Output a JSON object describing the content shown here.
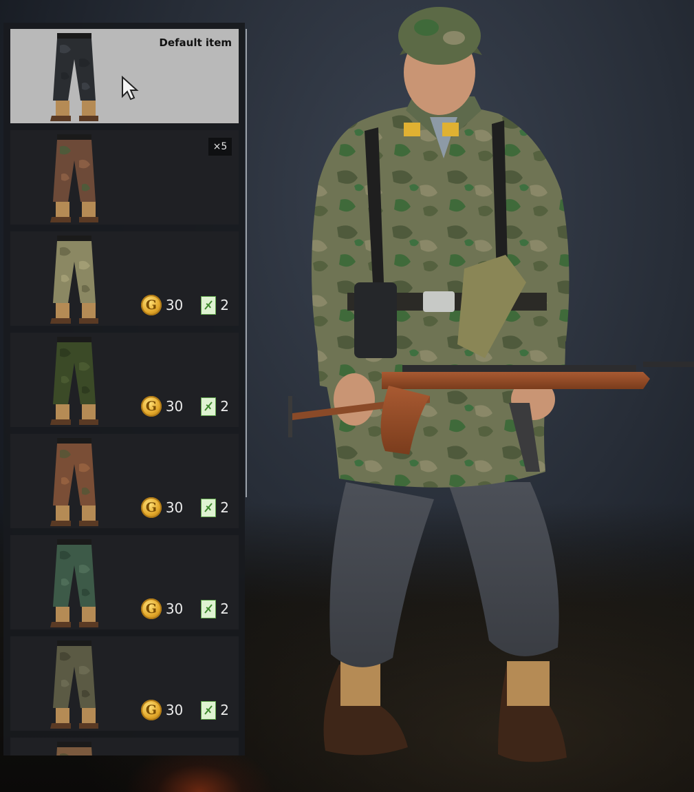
{
  "panel": {
    "items": [
      {
        "label": "Default item",
        "selected": true,
        "camo": [
          "#2a2d31",
          "#3b3f45",
          "#23262a"
        ]
      },
      {
        "badge": "×5",
        "camo": [
          "#6d4a38",
          "#4f5a3a",
          "#8a5e44"
        ]
      },
      {
        "price": {
          "gold": "30",
          "tickets": "2"
        },
        "camo": [
          "#8b8863",
          "#6e6c4c",
          "#a29d74"
        ]
      },
      {
        "price": {
          "gold": "30",
          "tickets": "2"
        },
        "camo": [
          "#3b4a27",
          "#2e3b1f",
          "#4a5a31"
        ]
      },
      {
        "price": {
          "gold": "30",
          "tickets": "2"
        },
        "camo": [
          "#7a4e36",
          "#5b5536",
          "#94603f"
        ]
      },
      {
        "price": {
          "gold": "30",
          "tickets": "2"
        },
        "camo": [
          "#3d5a48",
          "#2f4839",
          "#4e6d58"
        ]
      },
      {
        "price": {
          "gold": "30",
          "tickets": "2"
        },
        "camo": [
          "#5b5a44",
          "#474634",
          "#6b6a52"
        ]
      },
      {
        "camo": [
          "#7b5a3e",
          "#5a5236",
          "#8c6a48"
        ]
      }
    ]
  },
  "icons": {
    "gold": "gold-coin-icon",
    "ticket": "order-ticket-icon",
    "cursor": "mouse-cursor-icon",
    "gold_glyph": "G"
  },
  "colors": {
    "selected_bg": "#b9b9b9",
    "item_bg": "#1f2024",
    "gold": "#e3a82b",
    "ticket_green": "#5ea44a"
  }
}
